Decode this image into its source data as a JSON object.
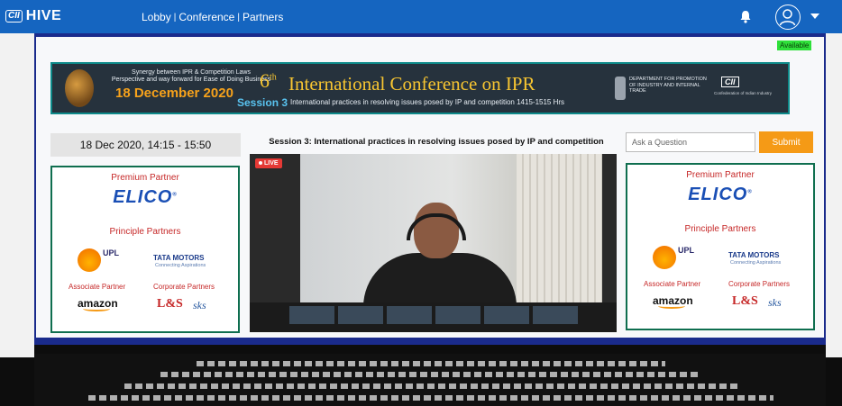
{
  "header": {
    "logo_cii": "CII",
    "logo_hive": "HIVE",
    "nav": [
      {
        "label": "Lobby"
      },
      {
        "label": "Conference"
      },
      {
        "label": "Partners"
      }
    ],
    "nav_separator": "|"
  },
  "status": {
    "available": "Available"
  },
  "banner": {
    "synergy_line1": "Synergy between IPR & Competition Laws",
    "synergy_line2": "Perspective and way forward for Ease of Doing Business",
    "date": "18 December 2020",
    "edition": "6",
    "edition_suffix": "th",
    "title": "International Conference on IPR",
    "session": "Session 3",
    "session_desc": "International practices in resolving issues posed by IP and competition 1415-1515 Hrs",
    "dept": "DEPARTMENT FOR PROMOTION OF INDUSTRY AND INTERNAL TRADE",
    "cii": "CII",
    "cii_sub": "Confederation of Indian Industry"
  },
  "session_time": "18 Dec 2020, 14:15 - 15:50",
  "session_title": "Session 3: International practices in resolving issues posed by IP and competition",
  "qa": {
    "placeholder": "Ask a Question",
    "submit": "Submit"
  },
  "partners": {
    "premium_heading": "Premium Partner",
    "premium": "ELICO",
    "premium_reg": "®",
    "principle_heading": "Principle Partners",
    "upl": "UPL",
    "tata": "TATA MOTORS",
    "tata_sub": "Connecting Aspirations",
    "associate_heading": "Associate Partner",
    "amazon": "amazon",
    "corporate_heading": "Corporate Partners",
    "ls": "L&S",
    "sks": "sks"
  },
  "video": {
    "live": "LIVE"
  },
  "colors": {
    "topbar": "#1565c0",
    "stage_border": "#1a2b8c",
    "submit": "#f59a16",
    "partner_heading": "#c62828",
    "elico": "#1a4fb5",
    "available": "#2fe03a"
  },
  "icons": [
    "bell-icon",
    "user-profile-icon",
    "chevron-down-icon"
  ]
}
